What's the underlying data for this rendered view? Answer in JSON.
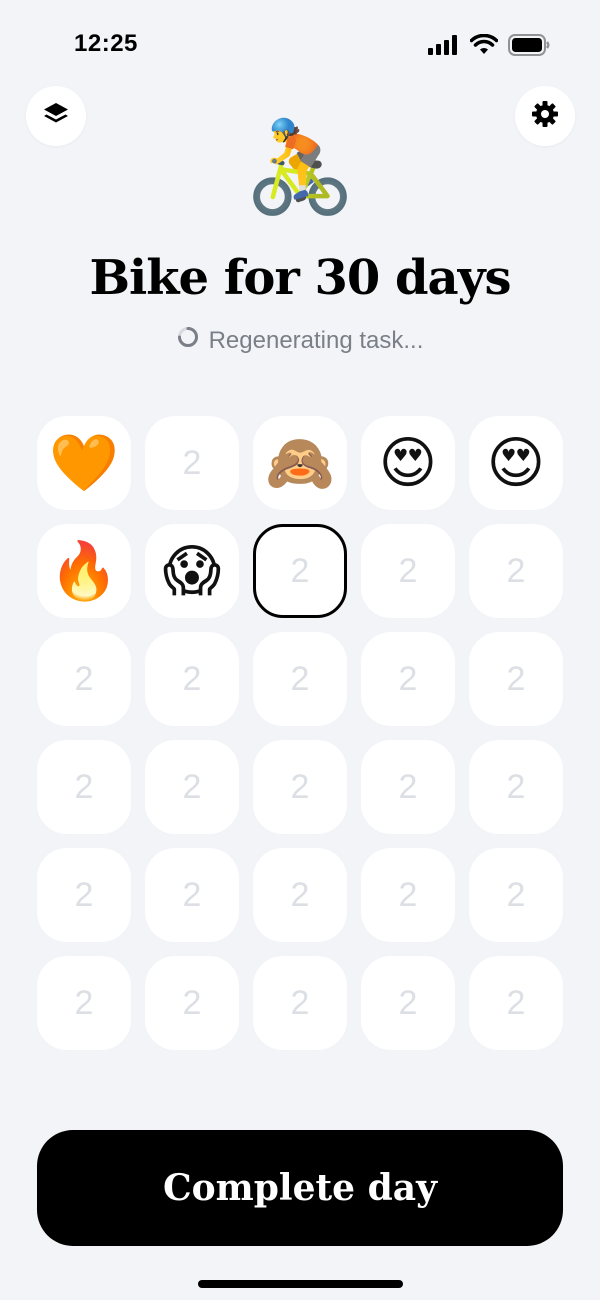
{
  "status_bar": {
    "time": "12:25"
  },
  "header": {
    "left_icon": "layers-icon",
    "right_icon": "gear-icon",
    "hero_emoji": "🚴",
    "title": "Bike for 30 days",
    "status_text": "Regenerating task..."
  },
  "grid": {
    "cells": [
      {
        "content": "🧡",
        "type": "emoji"
      },
      {
        "content": "2",
        "type": "number"
      },
      {
        "content": "🙈",
        "type": "emoji"
      },
      {
        "content": "😍",
        "type": "emoji"
      },
      {
        "content": "😍",
        "type": "emoji"
      },
      {
        "content": "🔥",
        "type": "emoji"
      },
      {
        "content": "😱",
        "type": "emoji"
      },
      {
        "content": "2",
        "type": "number",
        "current": true
      },
      {
        "content": "2",
        "type": "number"
      },
      {
        "content": "2",
        "type": "number"
      },
      {
        "content": "2",
        "type": "number"
      },
      {
        "content": "2",
        "type": "number"
      },
      {
        "content": "2",
        "type": "number"
      },
      {
        "content": "2",
        "type": "number"
      },
      {
        "content": "2",
        "type": "number"
      },
      {
        "content": "2",
        "type": "number"
      },
      {
        "content": "2",
        "type": "number"
      },
      {
        "content": "2",
        "type": "number"
      },
      {
        "content": "2",
        "type": "number"
      },
      {
        "content": "2",
        "type": "number"
      },
      {
        "content": "2",
        "type": "number"
      },
      {
        "content": "2",
        "type": "number"
      },
      {
        "content": "2",
        "type": "number"
      },
      {
        "content": "2",
        "type": "number"
      },
      {
        "content": "2",
        "type": "number"
      },
      {
        "content": "2",
        "type": "number"
      },
      {
        "content": "2",
        "type": "number"
      },
      {
        "content": "2",
        "type": "number"
      },
      {
        "content": "2",
        "type": "number"
      },
      {
        "content": "2",
        "type": "number"
      }
    ]
  },
  "footer": {
    "complete_label": "Complete day"
  },
  "colors": {
    "background": "#f2f4f8",
    "cell": "#ffffff",
    "placeholder_number": "#dcdfe4",
    "button": "#000000",
    "muted_text": "#7a7f88"
  }
}
